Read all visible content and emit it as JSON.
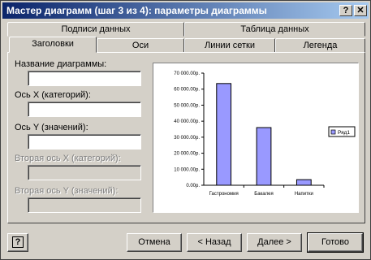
{
  "window": {
    "title": "Мастер диаграмм (шаг 3 из 4): параметры диаграммы"
  },
  "titlebar_buttons": {
    "help": "?",
    "close": "✕"
  },
  "tabs": {
    "back_row": [
      "Подписи данных",
      "Таблица данных"
    ],
    "front_row": [
      "Заголовки",
      "Оси",
      "Линии сетки",
      "Легенда"
    ],
    "active": "Заголовки"
  },
  "fields": [
    {
      "label": "Название диаграммы:",
      "value": "",
      "enabled": true
    },
    {
      "label": "Ось X (категорий):",
      "value": "",
      "enabled": true
    },
    {
      "label": "Ось Y (значений):",
      "value": "",
      "enabled": true
    },
    {
      "label": "Вторая ось X (категорий):",
      "value": "",
      "enabled": false
    },
    {
      "label": "Вторая ось Y (значений):",
      "value": "",
      "enabled": false
    }
  ],
  "chart_data": {
    "type": "bar",
    "categories": [
      "Гастрономия",
      "Бакалея",
      "Напитки"
    ],
    "series": [
      {
        "name": "Ряд1",
        "values": [
          63500,
          36000,
          3500
        ]
      }
    ],
    "ylim": [
      0,
      70000
    ],
    "yticks": [
      "0.00р.",
      "10 000.00р.",
      "20 000.00р.",
      "30 000.00р.",
      "40 000.00р.",
      "50 000.00р.",
      "60 000.00р.",
      "70 000.00р."
    ],
    "grid": false,
    "legend_position": "right",
    "bar_color": "#9999ff",
    "title": "",
    "xlabel": "",
    "ylabel": ""
  },
  "buttons": {
    "help_icon": "?",
    "cancel": "Отмена",
    "back": "< Назад",
    "next": "Далее >",
    "finish": "Готово"
  }
}
